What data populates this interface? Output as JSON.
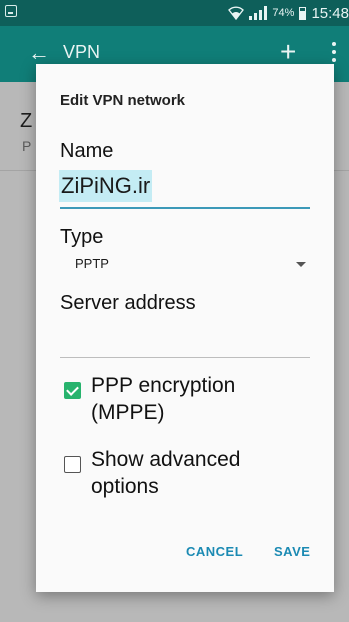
{
  "status_bar": {
    "battery_percent": "74%",
    "time": "15:48",
    "icons": [
      "screenshot-icon",
      "wifi-icon",
      "signal-icon",
      "battery-icon"
    ]
  },
  "toolbar": {
    "title": "VPN",
    "back_icon": "arrow-left-icon",
    "add_icon": "plus-icon",
    "menu_icon": "overflow-menu-icon",
    "color": "#107e78"
  },
  "background_list": {
    "item_name": "Z",
    "item_sub": "P"
  },
  "dialog": {
    "title": "Edit VPN network",
    "name_label": "Name",
    "name_value": "ZiPiNG.ir",
    "type_label": "Type",
    "type_value": "PPTP",
    "server_label": "Server address",
    "server_value": "",
    "ppp_encryption": {
      "label_line1": "PPP encryption",
      "label_line2": "(MPPE)",
      "checked": true
    },
    "advanced_options": {
      "label_line1": "Show advanced",
      "label_line2": "options",
      "checked": false
    },
    "cancel_label": "CANCEL",
    "save_label": "SAVE",
    "accent_color": "#1b8ab3"
  }
}
